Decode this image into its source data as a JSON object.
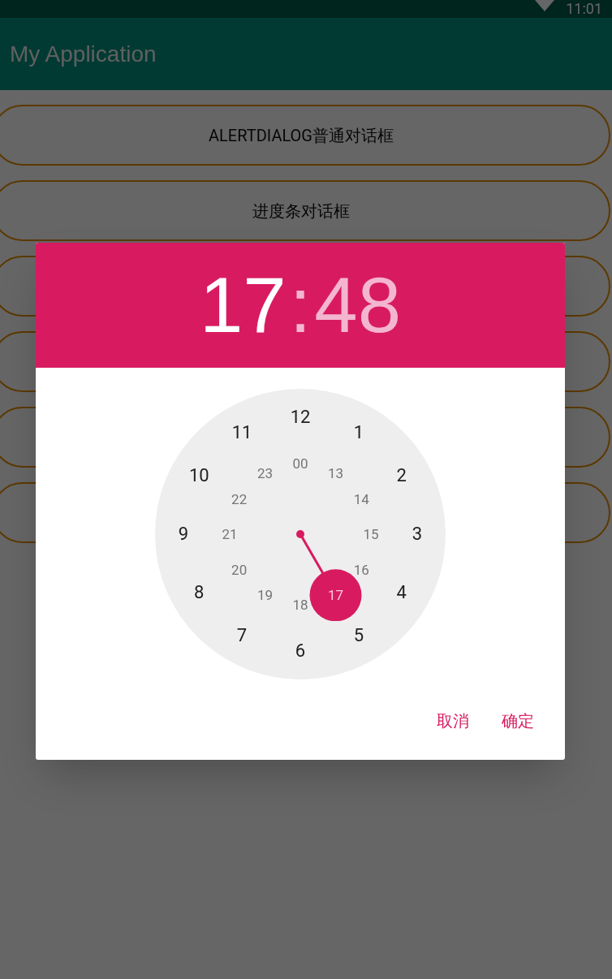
{
  "status_bar": {
    "time": "11:01"
  },
  "app_bar": {
    "title": "My Application"
  },
  "buttons": [
    {
      "kind": "labeled",
      "label": "ALERTDIALOG普通对话框"
    },
    {
      "kind": "labeled",
      "label": "进度条对话框"
    },
    {
      "kind": "covered"
    },
    {
      "kind": "covered"
    },
    {
      "kind": "covered"
    },
    {
      "kind": "covered"
    }
  ],
  "time_picker": {
    "hour": "17",
    "separator": ":",
    "minute": "48",
    "hour_selected": true,
    "outer_ring": [
      {
        "label": "12",
        "selected": false
      },
      {
        "label": "1",
        "selected": false
      },
      {
        "label": "2",
        "selected": false
      },
      {
        "label": "3",
        "selected": false
      },
      {
        "label": "4",
        "selected": false
      },
      {
        "label": "5",
        "selected": false
      },
      {
        "label": "6",
        "selected": false
      },
      {
        "label": "7",
        "selected": false
      },
      {
        "label": "8",
        "selected": false
      },
      {
        "label": "9",
        "selected": false
      },
      {
        "label": "10",
        "selected": false
      },
      {
        "label": "11",
        "selected": false
      }
    ],
    "inner_ring": [
      {
        "label": "00",
        "selected": false
      },
      {
        "label": "13",
        "selected": false
      },
      {
        "label": "14",
        "selected": false
      },
      {
        "label": "15",
        "selected": false
      },
      {
        "label": "16",
        "selected": false
      },
      {
        "label": "17",
        "selected": true
      },
      {
        "label": "18",
        "selected": false
      },
      {
        "label": "19",
        "selected": false
      },
      {
        "label": "20",
        "selected": false
      },
      {
        "label": "21",
        "selected": false
      },
      {
        "label": "22",
        "selected": false
      },
      {
        "label": "23",
        "selected": false
      }
    ],
    "actions": [
      "取消",
      "确定"
    ]
  }
}
